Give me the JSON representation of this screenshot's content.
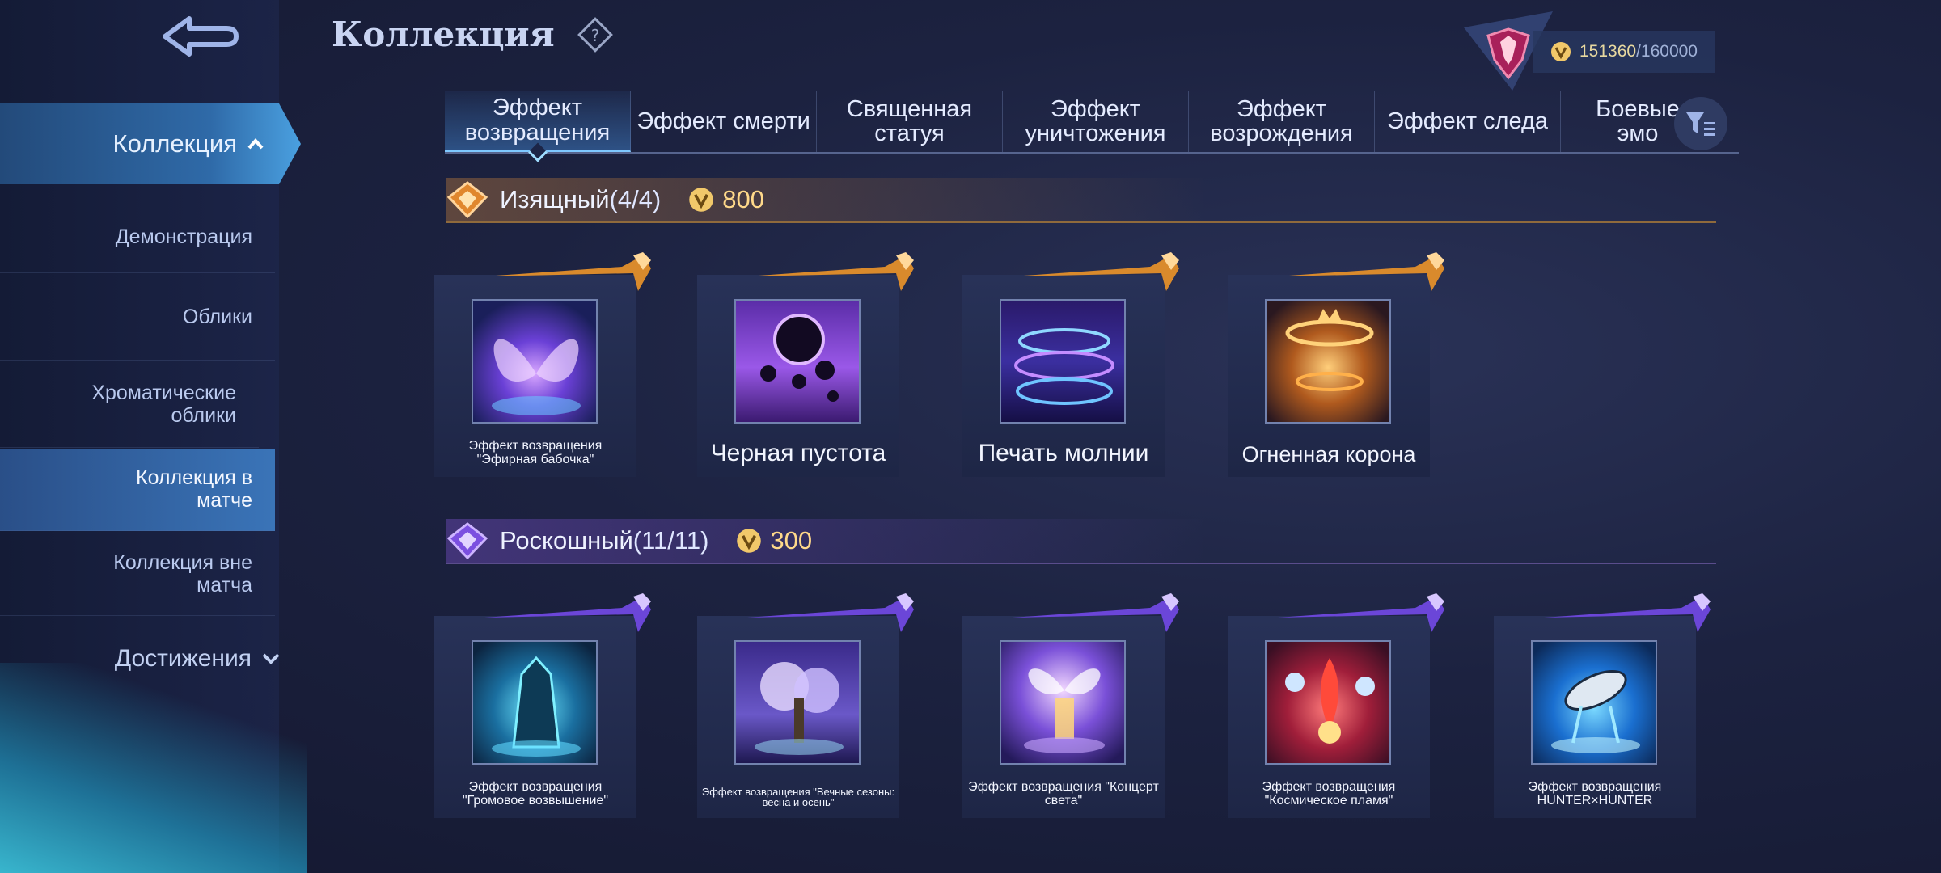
{
  "header": {
    "title": "Коллекция",
    "currency": {
      "current": "151360",
      "max": "/160000"
    }
  },
  "sidebar": {
    "main": "Коллекция",
    "items": [
      {
        "label": "Демонстрация"
      },
      {
        "label": "Облики"
      },
      {
        "label": "Хроматические облики"
      },
      {
        "label": "Коллекция в матче"
      },
      {
        "label": "Коллекция вне матча"
      }
    ],
    "achievements": "Достижения"
  },
  "tabs": [
    {
      "label": "Эффект возвращения"
    },
    {
      "label": "Эффект смерти"
    },
    {
      "label": "Священная статуя"
    },
    {
      "label": "Эффект уничтожения"
    },
    {
      "label": "Эффект возрождения"
    },
    {
      "label": "Эффект следа"
    },
    {
      "label": "Боевые эмо"
    }
  ],
  "sections": [
    {
      "name": "Изящный",
      "count": "(4/4)",
      "points": "800",
      "color": "#e89a3c",
      "items": [
        {
          "label": "Эффект возвращения \"Эфирная бабочка\""
        },
        {
          "label": "Черная пустота"
        },
        {
          "label": "Печать молнии"
        },
        {
          "label": "Огненная корона"
        }
      ]
    },
    {
      "name": "Роскошный",
      "count": "(11/11)",
      "points": "300",
      "color": "#9a6cf0",
      "items": [
        {
          "label": "Эффект возвращения \"Громовое возвышение\""
        },
        {
          "label": "Эффект возвращения \"Вечные сезоны: весна и осень\""
        },
        {
          "label": "Эффект возвращения \"Концерт света\""
        },
        {
          "label": "Эффект возвращения \"Космическое пламя\""
        },
        {
          "label": "Эффект возвращения HUNTER×HUNTER"
        }
      ]
    }
  ]
}
